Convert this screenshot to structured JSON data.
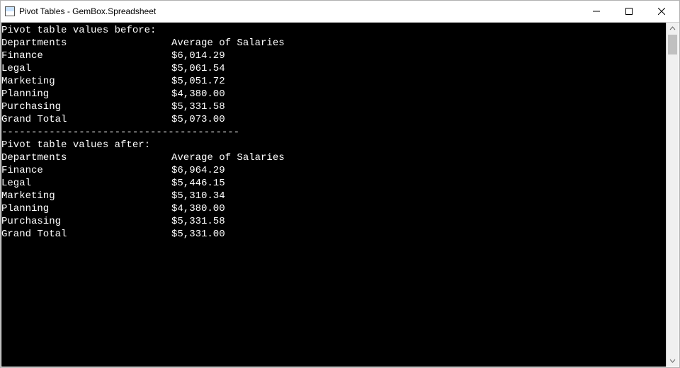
{
  "window": {
    "title": "Pivot Tables - GemBox.Spreadsheet"
  },
  "console": {
    "before_heading": "Pivot table values before:",
    "after_heading": "Pivot table values after:",
    "divider": "----------------------------------------",
    "label_dep": "Departments",
    "label_col": "Average of Salaries",
    "before": {
      "r0": {
        "name": "Finance",
        "val": "$6,014.29"
      },
      "r1": {
        "name": "Legal",
        "val": "$5,061.54"
      },
      "r2": {
        "name": "Marketing",
        "val": "$5,051.72"
      },
      "r3": {
        "name": "Planning",
        "val": "$4,380.00"
      },
      "r4": {
        "name": "Purchasing",
        "val": "$5,331.58"
      },
      "r5": {
        "name": "Grand Total",
        "val": "$5,073.00"
      }
    },
    "after": {
      "r0": {
        "name": "Finance",
        "val": "$6,964.29"
      },
      "r1": {
        "name": "Legal",
        "val": "$5,446.15"
      },
      "r2": {
        "name": "Marketing",
        "val": "$5,310.34"
      },
      "r3": {
        "name": "Planning",
        "val": "$4,380.00"
      },
      "r4": {
        "name": "Purchasing",
        "val": "$5,331.58"
      },
      "r5": {
        "name": "Grand Total",
        "val": "$5,331.00"
      }
    }
  }
}
